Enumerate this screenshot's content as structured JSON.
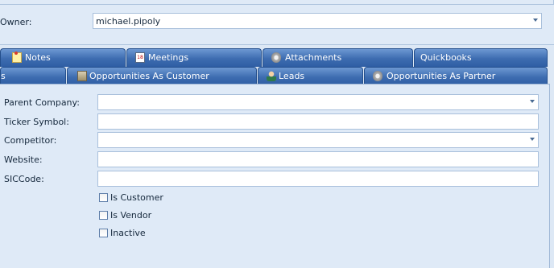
{
  "owner": {
    "label": "Owner:",
    "value": "michael.pipoly"
  },
  "tabs_row1": [
    {
      "label": "Notes",
      "icon": "note-icon"
    },
    {
      "label": "Meetings",
      "icon": "calendar-icon"
    },
    {
      "label": "Attachments",
      "icon": "attachment-icon"
    },
    {
      "label": "Quickbooks",
      "icon": ""
    }
  ],
  "tabs_row2": [
    {
      "label": "s"
    },
    {
      "label": "Opportunities As Customer",
      "icon": "box-icon"
    },
    {
      "label": "Leads",
      "icon": "person-icon"
    },
    {
      "label": "Opportunities As Partner",
      "icon": "gear-icon"
    }
  ],
  "form": {
    "parent_company": {
      "label": "Parent Company:",
      "value": ""
    },
    "ticker_symbol": {
      "label": "Ticker Symbol:",
      "value": ""
    },
    "competitor": {
      "label": "Competitor:",
      "value": ""
    },
    "website": {
      "label": "Website:",
      "value": ""
    },
    "sic_code": {
      "label": "SICCode:",
      "value": ""
    }
  },
  "checkboxes": [
    {
      "label": "Is Customer",
      "checked": false
    },
    {
      "label": "Is Vendor",
      "checked": false
    },
    {
      "label": "Inactive",
      "checked": false
    }
  ]
}
